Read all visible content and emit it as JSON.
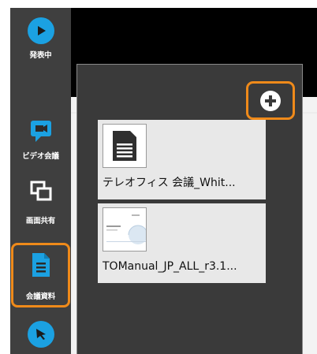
{
  "sidebar": {
    "items": [
      {
        "label": "発表中",
        "icon": "play-icon"
      },
      {
        "label": "ビデオ会議",
        "icon": "video-chat-icon"
      },
      {
        "label": "画面共有",
        "icon": "screen-share-icon"
      },
      {
        "label": "会議資料",
        "icon": "document-icon",
        "highlighted": true
      },
      {
        "label": "",
        "icon": "pointer-icon"
      }
    ]
  },
  "panel": {
    "add_button_icon": "add-circle-icon",
    "documents": [
      {
        "name": "テレオフィス 会議_Whit...",
        "thumbnail": "file-icon"
      },
      {
        "name": "TOManual_JP_ALL_r3.1...",
        "thumbnail": "page-preview"
      }
    ]
  },
  "colors": {
    "accent": "#1ba1e2",
    "highlight": "#ef8a1a",
    "sidebar": "#3f3f3f",
    "panel": "#3a3a3a"
  }
}
